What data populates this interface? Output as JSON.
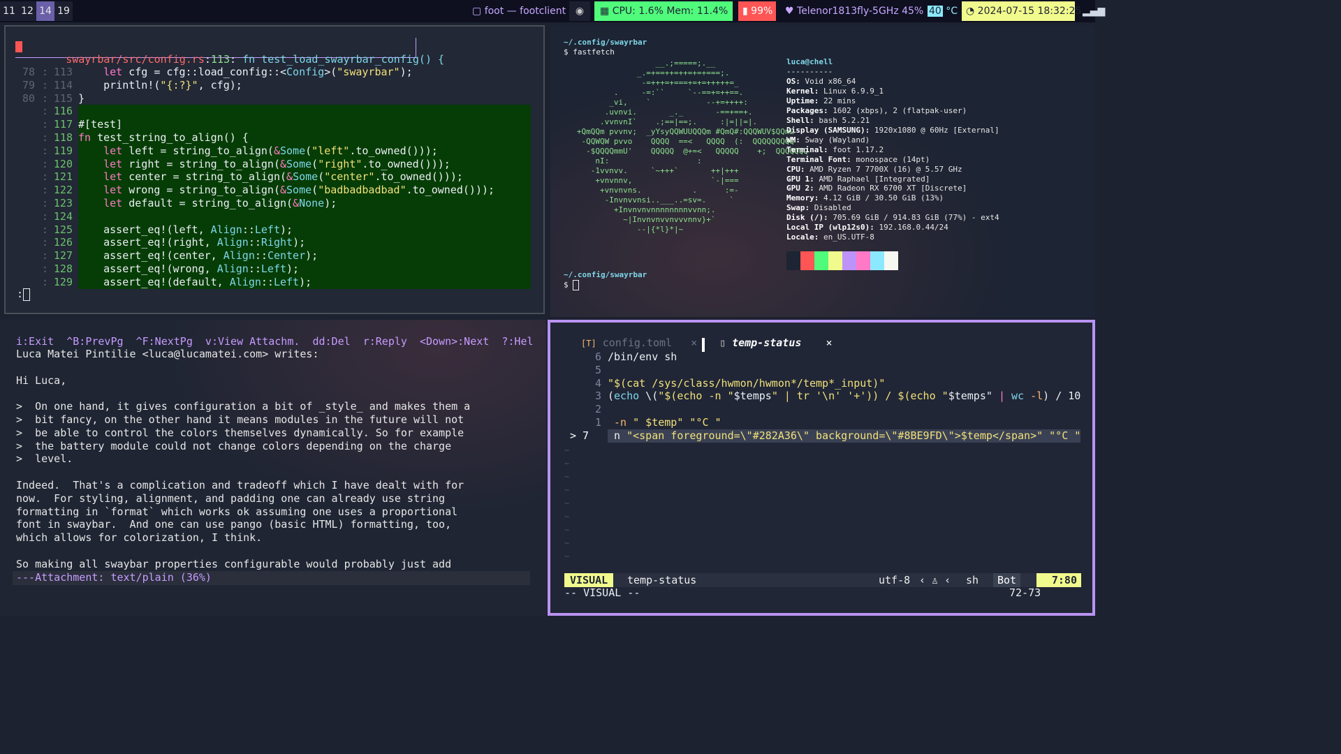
{
  "bar": {
    "workspaces": [
      "11",
      "12",
      "14",
      "19"
    ],
    "active_workspace": "14",
    "window_title": "foot — footclient",
    "cpu_label": "CPU:  1.6% Mem: 11.4%",
    "battery": "99%",
    "wifi": "Telenor1813fly-5GHz  45%",
    "temp_value": "40",
    "temp_unit": "°C",
    "datetime": "2024-07-15 18:32:25",
    "colors": {
      "cpu_bg": "#50fa7b",
      "battery_bg": "#ff5555",
      "date_bg": "#f1fa8c",
      "active_ws": "#6a5fa8"
    }
  },
  "editor_top": {
    "header_path": "swayrbar/src/config.rs",
    "header_line": "113",
    "header_fn": "fn test_load_swayrbar_config() {",
    "rows": [
      {
        "rel": "78",
        "abs": "113",
        "code": "    let cfg = cfg::load_config::<Config>(\"swayrbar\");"
      },
      {
        "rel": "79",
        "abs": "114",
        "code": "    println!(\"{:?}\", cfg);"
      },
      {
        "rel": "80",
        "abs": "115",
        "code": "}"
      },
      {
        "rel": "",
        "abs": "116",
        "code": ""
      },
      {
        "rel": "",
        "abs": "117",
        "code": "#[test]"
      },
      {
        "rel": "",
        "abs": "118",
        "code": "fn test_string_to_align() {"
      },
      {
        "rel": "",
        "abs": "119",
        "code": "    let left = string_to_align(&Some(\"left\".to_owned()));"
      },
      {
        "rel": "",
        "abs": "120",
        "code": "    let right = string_to_align(&Some(\"right\".to_owned()));"
      },
      {
        "rel": "",
        "abs": "121",
        "code": "    let center = string_to_align(&Some(\"center\".to_owned()));"
      },
      {
        "rel": "",
        "abs": "122",
        "code": "    let wrong = string_to_align(&Some(\"badbadbadbad\".to_owned()));"
      },
      {
        "rel": "",
        "abs": "123",
        "code": "    let default = string_to_align(&None);"
      },
      {
        "rel": "",
        "abs": "124",
        "code": ""
      },
      {
        "rel": "",
        "abs": "125",
        "code": "    assert_eq!(left, Align::Left);"
      },
      {
        "rel": "",
        "abs": "126",
        "code": "    assert_eq!(right, Align::Right);"
      },
      {
        "rel": "",
        "abs": "127",
        "code": "    assert_eq!(center, Align::Center);"
      },
      {
        "rel": "",
        "abs": "128",
        "code": "    assert_eq!(wrong, Align::Left);"
      },
      {
        "rel": "",
        "abs": "129",
        "code": "    assert_eq!(default, Align::Left);"
      }
    ],
    "command_line": ":"
  },
  "fastfetch": {
    "cwd": "~/.config/swayrbar",
    "command": "$ fastfetch",
    "prompt": "$",
    "logo": [
      "                    __.;=====;.__",
      "                _.=+==++=++=+=+===;.",
      "                 -=+++=+===+=+=+++++=_",
      "           .     -=:``     `--==+=++==.",
      "          _vi,    `            --+=++++:",
      "         .uvnvi.       _._       -==+==+.",
      "        .vvnvnI`    .;==|==;.     :|=||=|.",
      "   +QmQQm pvvnv;  _yYsyQQWUUQQQm #QmQ#:QQQWUV$QQmL",
      "    -QQWQW pvvo    QQQQ  ==<   QQQQ  (:  QQQQQQQQQ",
      "     -$QQQQmmU'    QQQQQ  @+=<   QQQQQ    +;  QQQQQQQ",
      "       nI:                   :              ",
      "      -1vvnvv.     `~+++`       ++|+++",
      "       +vnvnnv,                 `-|===",
      "        +vnvnvns.           .      :=-",
      "         -Invnvvnsi..___..=sv=.     `",
      "           +Invnvnvnnnnnnnnvvnn;.",
      "             ~|Invnvnvvnvvvnnv}+`",
      "                --|{*l}*|~"
    ],
    "user_host": "luca@chell",
    "separator": "----------",
    "info": [
      {
        "k": "OS",
        "v": "Void x86_64"
      },
      {
        "k": "Kernel",
        "v": "Linux 6.9.9_1"
      },
      {
        "k": "Uptime",
        "v": "22 mins"
      },
      {
        "k": "Packages",
        "v": "1602 (xbps), 2 (flatpak-user)"
      },
      {
        "k": "Shell",
        "v": "bash 5.2.21"
      },
      {
        "k": "Display (SAMSUNG)",
        "v": "1920x1080 @ 60Hz [External]"
      },
      {
        "k": "WM",
        "v": "Sway (Wayland)"
      },
      {
        "k": "Terminal",
        "v": "foot 1.17.2"
      },
      {
        "k": "Terminal Font",
        "v": "monospace (14pt)"
      },
      {
        "k": "CPU",
        "v": "AMD Ryzen 7 7700X (16) @ 5.57 GHz"
      },
      {
        "k": "GPU 1",
        "v": "AMD Raphael [Integrated]"
      },
      {
        "k": "GPU 2",
        "v": "AMD Radeon RX 6700 XT [Discrete]"
      },
      {
        "k": "Memory",
        "v": "4.12 GiB / 30.50 GiB (13%)"
      },
      {
        "k": "Swap",
        "v": "Disabled"
      },
      {
        "k": "Disk (/)",
        "v": "705.69 GiB / 914.83 GiB (77%) - ext4"
      },
      {
        "k": "Local IP (wlp12s0)",
        "v": "192.168.0.44/24"
      },
      {
        "k": "Locale",
        "v": "en_US.UTF-8"
      }
    ],
    "palette": [
      "#1d2433",
      "#ff5555",
      "#50fa7b",
      "#f1fa8c",
      "#bd93f9",
      "#ff79c6",
      "#8be9fd",
      "#f8f8f2"
    ]
  },
  "mail": {
    "help": "i:Exit  ^B:PrevPg  ^F:NextPg  v:View Attachm.  dd:Del  r:Reply  <Down>:Next  ?:Hel",
    "lines": [
      "Luca Matei Pintilie <luca@lucamatei.com> writes:",
      "",
      "Hi Luca,",
      "",
      ">  On one hand, it gives configuration a bit of _style_ and makes them a",
      ">  bit fancy, on the other hand it means modules in the future will not",
      ">  be able to control the colors themselves dynamically. So for example",
      ">  the battery module could not change colors depending on the charge",
      ">  level.",
      "",
      "Indeed.  That's a complication and tradeoff which I have dealt with for",
      "now.  For styling, alignment, and padding one can already use string",
      "formatting in `format` which works ok assuming one uses a proportional",
      "font in swaybar.  And one can use pango (basic HTML) formatting, too,",
      "which allows for colorization, I think.",
      "",
      "So making all swaybar properties configurable would probably just add"
    ],
    "status": "---Attachment: text/plain (36%)"
  },
  "vim": {
    "tabs": [
      {
        "icon": "[T]",
        "label": "config.toml",
        "close": "×"
      },
      {
        "icon": "▯",
        "label": "temp-status",
        "close": "×"
      }
    ],
    "rows": [
      {
        "num": "6",
        "code": "/bin/env sh"
      },
      {
        "num": "5",
        "code": ""
      },
      {
        "num": "4",
        "code": "\"$(cat /sys/class/hwmon/hwmon*/temp*_input)\""
      },
      {
        "num": "3",
        "code": "(echo \\(\"$(echo -n \"$temps\" | tr '\\n' '+')) / $(echo \"$temps\" | wc -l) / 10"
      },
      {
        "num": "2",
        "code": ""
      },
      {
        "num": "1",
        "code": " -n \" $temp\" \"°C \""
      },
      {
        "num": "> 7",
        "code": " n \"<span foreground=\\\"#282A36\\\" background=\\\"#8BE9FD\\\">$temp</span>\" \"°C \""
      }
    ],
    "tildes": 9,
    "statusline": {
      "mode": "VISUAL",
      "file": "temp-status",
      "enc": "utf-8",
      "ft": "sh",
      "pos": "Bot",
      "linecol": "7:80"
    },
    "cmdline": "-- VISUAL --",
    "sel_range": "72-73"
  }
}
